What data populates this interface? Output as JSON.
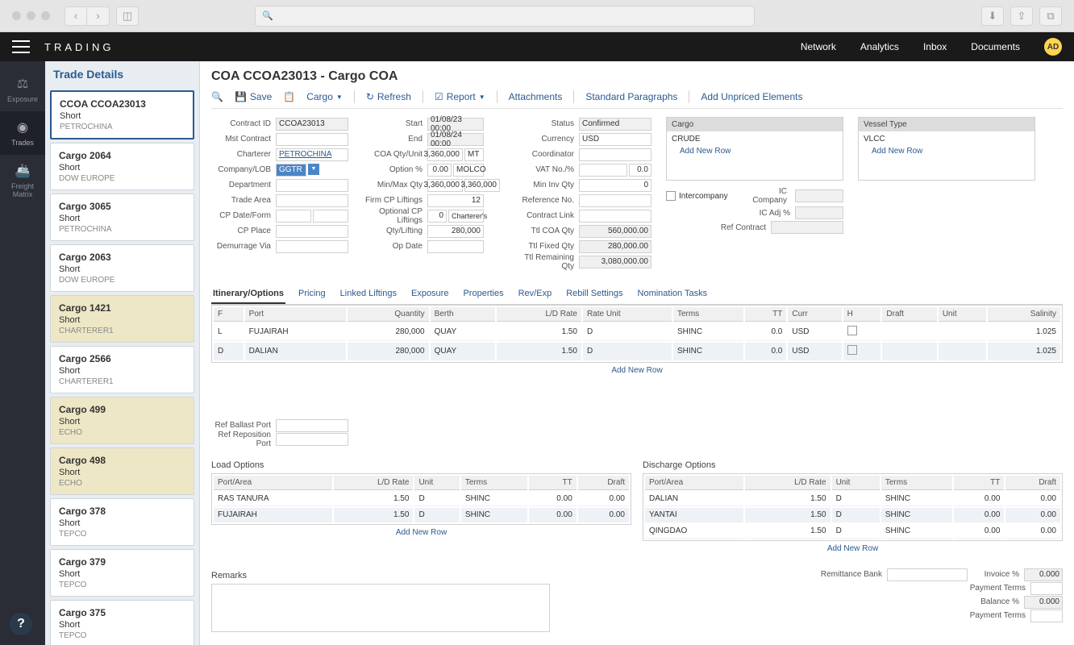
{
  "app": {
    "title": "TRADING",
    "avatar": "AD"
  },
  "nav": {
    "network": "Network",
    "analytics": "Analytics",
    "inbox": "Inbox",
    "documents": "Documents"
  },
  "rail": {
    "exposure": "Exposure",
    "trades": "Trades",
    "freight": "Freight Matrix"
  },
  "sidebar": {
    "title": "Trade Details",
    "items": [
      {
        "title": "CCOA CCOA23013",
        "pos": "Short",
        "comp": "PETROCHINA",
        "sel": true
      },
      {
        "title": "Cargo 2064",
        "pos": "Short",
        "comp": "DOW EUROPE"
      },
      {
        "title": "Cargo 3065",
        "pos": "Short",
        "comp": "PETROCHINA"
      },
      {
        "title": "Cargo 2063",
        "pos": "Short",
        "comp": "DOW EUROPE"
      },
      {
        "title": "Cargo 1421",
        "pos": "Short",
        "comp": "CHARTERER1",
        "hl": true
      },
      {
        "title": "Cargo 2566",
        "pos": "Short",
        "comp": "CHARTERER1"
      },
      {
        "title": "Cargo 499",
        "pos": "Short",
        "comp": "ECHO",
        "hl": true
      },
      {
        "title": "Cargo 498",
        "pos": "Short",
        "comp": "ECHO",
        "hl": true
      },
      {
        "title": "Cargo 378",
        "pos": "Short",
        "comp": "TEPCO"
      },
      {
        "title": "Cargo 379",
        "pos": "Short",
        "comp": "TEPCO"
      },
      {
        "title": "Cargo 375",
        "pos": "Short",
        "comp": "TEPCO"
      }
    ]
  },
  "page": {
    "title": "COA CCOA23013 - Cargo COA"
  },
  "toolbar": {
    "save": "Save",
    "cargo": "Cargo",
    "refresh": "Refresh",
    "report": "Report",
    "attachments": "Attachments",
    "paragraphs": "Standard Paragraphs",
    "unpriced": "Add Unpriced Elements"
  },
  "form": {
    "contract_id_l": "Contract ID",
    "contract_id": "CCOA23013",
    "mst_contract_l": "Mst Contract",
    "charterer_l": "Charterer",
    "charterer": "PETROCHINA",
    "company_lob_l": "Company/LOB",
    "company_lob": "GGTR",
    "department_l": "Department",
    "trade_area_l": "Trade Area",
    "cp_date_form_l": "CP Date/Form",
    "cp_place_l": "CP Place",
    "demurrage_via_l": "Demurrage Via",
    "start_l": "Start",
    "start": "01/08/23 00:00",
    "end_l": "End",
    "end": "01/08/24 00:00",
    "coa_qty_l": "COA Qty/Unit",
    "coa_qty": "3,360,000",
    "coa_unit": "MT",
    "option_pct_l": "Option %",
    "option_pct": "0.00",
    "option_ref": "MOLCO",
    "minmax_l": "Min/Max Qty",
    "min_qty": "3,360,000",
    "max_qty": "3,360,000",
    "firm_cp_l": "Firm CP Liftings",
    "firm_cp": "12",
    "opt_cp_l": "Optional CP Liftings",
    "opt_cp": "0",
    "opt_cp_side": "Charterer's",
    "qty_lift_l": "Qty/Lifting",
    "qty_lift": "280,000",
    "op_date_l": "Op Date",
    "status_l": "Status",
    "status": "Confirmed",
    "currency_l": "Currency",
    "currency": "USD",
    "coordinator_l": "Coordinator",
    "vat_l": "VAT No./%",
    "vat_pct": "0.0",
    "min_inv_l": "Min Inv Qty",
    "min_inv": "0",
    "ref_no_l": "Reference No.",
    "contract_link_l": "Contract Link",
    "ttl_coa_l": "Ttl COA Qty",
    "ttl_coa": "560,000.00",
    "ttl_fixed_l": "Ttl Fixed Qty",
    "ttl_fixed": "280,000.00",
    "ttl_rem_l": "Ttl Remaining Qty",
    "ttl_rem": "3,080,000.00",
    "cargo_panel": "Cargo",
    "cargo_val": "CRUDE",
    "vessel_panel": "Vessel Type",
    "vessel_val": "VLCC",
    "add_new_row": "Add New Row",
    "intercompany_l": "Intercompany",
    "ic_company_l": "IC Company",
    "ic_adj_l": "IC Adj %",
    "ref_contract_l": "Ref Contract"
  },
  "tabs": {
    "itin": "Itinerary/Options",
    "pricing": "Pricing",
    "linked": "Linked Liftings",
    "exposure": "Exposure",
    "props": "Properties",
    "revexp": "Rev/Exp",
    "rebill": "Rebill Settings",
    "nom": "Nomination Tasks"
  },
  "itin_cols": {
    "f": "F",
    "port": "Port",
    "qty": "Quantity",
    "berth": "Berth",
    "ld": "L/D Rate",
    "unit": "Rate Unit",
    "terms": "Terms",
    "tt": "TT",
    "curr": "Curr",
    "h": "H",
    "draft": "Draft",
    "unit2": "Unit",
    "salinity": "Salinity"
  },
  "itin_rows": [
    {
      "f": "L",
      "port": "FUJAIRAH",
      "qty": "280,000",
      "berth": "QUAY",
      "ld": "1.50",
      "unit": "D",
      "terms": "SHINC",
      "tt": "0.0",
      "curr": "USD",
      "salinity": "1.025"
    },
    {
      "f": "D",
      "port": "DALIAN",
      "qty": "280,000",
      "berth": "QUAY",
      "ld": "1.50",
      "unit": "D",
      "terms": "SHINC",
      "tt": "0.0",
      "curr": "USD",
      "salinity": "1.025"
    }
  ],
  "ref_ballast_l": "Ref Ballast Port",
  "ref_repos_l": "Ref Reposition Port",
  "load_title": "Load Options",
  "discharge_title": "Discharge Options",
  "opt_cols": {
    "port": "Port/Area",
    "ld": "L/D Rate",
    "unit": "Unit",
    "terms": "Terms",
    "tt": "TT",
    "draft": "Draft"
  },
  "load_rows": [
    {
      "port": "RAS TANURA",
      "ld": "1.50",
      "unit": "D",
      "terms": "SHINC",
      "tt": "0.00",
      "draft": "0.00"
    },
    {
      "port": "FUJAIRAH",
      "ld": "1.50",
      "unit": "D",
      "terms": "SHINC",
      "tt": "0.00",
      "draft": "0.00"
    }
  ],
  "disch_rows": [
    {
      "port": "DALIAN",
      "ld": "1.50",
      "unit": "D",
      "terms": "SHINC",
      "tt": "0.00",
      "draft": "0.00"
    },
    {
      "port": "YANTAI",
      "ld": "1.50",
      "unit": "D",
      "terms": "SHINC",
      "tt": "0.00",
      "draft": "0.00"
    },
    {
      "port": "QINGDAO",
      "ld": "1.50",
      "unit": "D",
      "terms": "SHINC",
      "tt": "0.00",
      "draft": "0.00"
    }
  ],
  "remarks_l": "Remarks",
  "remit": {
    "bank_l": "Remittance Bank",
    "pay_terms_l": "Payment Terms",
    "invoice_pct_l": "Invoice %",
    "invoice_pct": "0.000",
    "balance_pct_l": "Balance %",
    "balance_pct": "0.000"
  }
}
